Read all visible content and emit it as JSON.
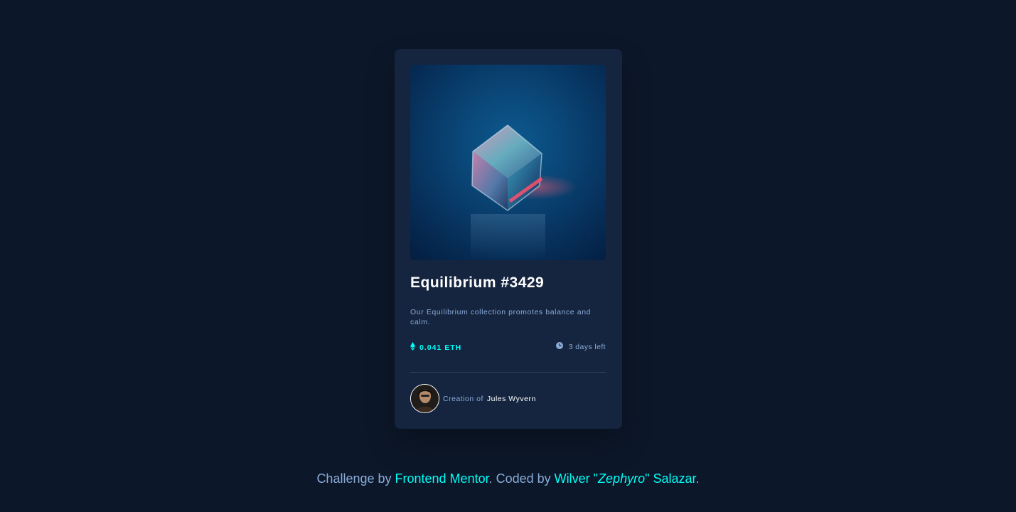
{
  "card": {
    "image_alt": "Equilibrium",
    "title": "Equilibrium #3429",
    "description": "Our Equilibrium collection promotes balance and calm.",
    "price": "0.041 ETH",
    "price_icon": "ethereum-icon",
    "time_left": "3 days left",
    "time_icon": "clock-icon",
    "creator_prefix": "Creation of ",
    "creator_name": "Jules Wyvern",
    "colors": {
      "card_bg": "#15253f",
      "accent": "#00fff8",
      "muted": "#8bacd9"
    }
  },
  "attribution": {
    "prefix": "Challenge by ",
    "challenge_link": "Frontend Mentor",
    "middle": ". Coded by ",
    "coder_first": "Wilver \"",
    "coder_nick": "Zephyro",
    "coder_last": "\" Salazar",
    "suffix": "."
  },
  "page": {
    "background": "#0c1729"
  }
}
